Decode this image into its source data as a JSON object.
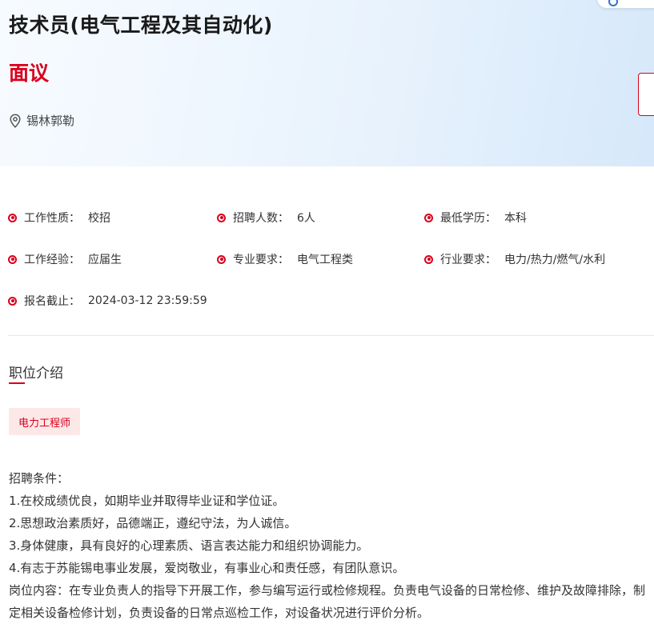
{
  "job": {
    "title": "技术员(电气工程及其自动化)",
    "salary": "面议",
    "location": "锡林郭勒"
  },
  "info": [
    {
      "label": "工作性质：",
      "value": "校招"
    },
    {
      "label": "招聘人数：",
      "value": "6人"
    },
    {
      "label": "最低学历：",
      "value": "本科"
    },
    {
      "label": "工作经验：",
      "value": "应届生"
    },
    {
      "label": "专业要求：",
      "value": "电气工程类"
    },
    {
      "label": "行业要求：",
      "value": "电力/热力/燃气/水利"
    },
    {
      "label": "报名截止：",
      "value": "2024-03-12 23:59:59"
    }
  ],
  "section": {
    "title": "职位介绍",
    "tag": "电力工程师"
  },
  "description": {
    "lines": [
      "招聘条件：",
      "1.在校成绩优良，如期毕业并取得毕业证和学位证。",
      "2.思想政治素质好，品德端正，遵纪守法，为人诚信。",
      "3.身体健康，具有良好的心理素质、语言表达能力和组织协调能力。",
      "4.有志于苏能锡电事业发展，爱岗敬业，有事业心和责任感，有团队意识。",
      "岗位内容：在专业负责人的指导下开展工作，参与编写运行或检修规程。负责电气设备的日常检修、维护及故障排除，制定相关设备检修计划，负责设备的日常点巡检工作，对设备状况进行评价分析。"
    ]
  },
  "colors": {
    "accent": "#d9001b",
    "tag_bg": "#fde8e8",
    "header_gradient_end": "#d6e8fa"
  }
}
